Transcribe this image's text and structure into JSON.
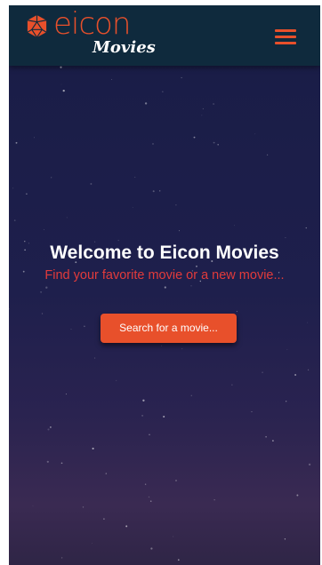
{
  "brand": {
    "name": "eicon",
    "sub": "Movies"
  },
  "hero": {
    "title": "Welcome to Eicon Movies",
    "subtitle": "Find your favorite movie or a new movie..."
  },
  "search_button": {
    "label": "Search for a movie..."
  },
  "colors": {
    "header": "#0f2a3d",
    "accent": "#e8502b",
    "subtitle": "#e23b3b"
  },
  "icons": {
    "logo": "polyhedron-logo-icon",
    "menu": "hamburger-menu-icon"
  }
}
